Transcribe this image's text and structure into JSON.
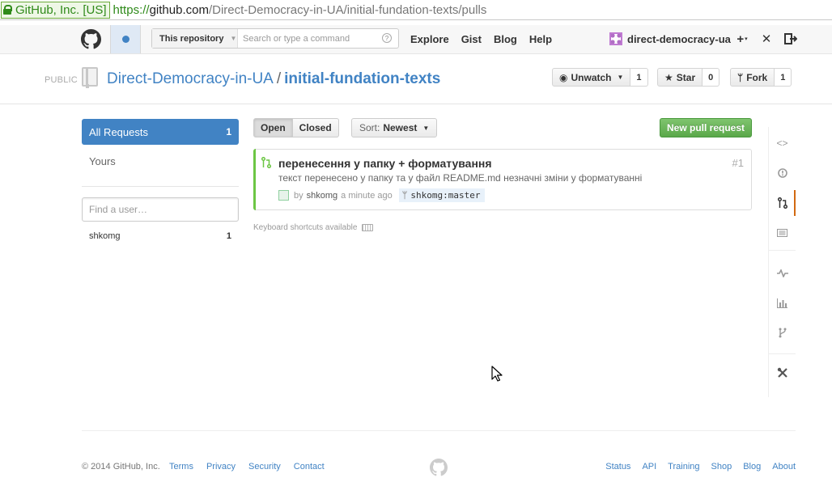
{
  "browser": {
    "identity": "GitHub, Inc. [US]",
    "url_scheme": "https://",
    "url_host": "github.com",
    "url_path": "/Direct-Democracy-in-UA/initial-fundation-texts/pulls"
  },
  "header": {
    "search_scope": "This repository",
    "search_placeholder": "Search or type a command",
    "search_help": "?",
    "nav": [
      "Explore",
      "Gist",
      "Blog",
      "Help"
    ],
    "username": "direct-democracy-ua",
    "plus_icon": "plus-icon",
    "settings_icon": "tools-icon",
    "signout_icon": "sign-out-icon"
  },
  "repo": {
    "visibility": "PUBLIC",
    "owner": "Direct-Democracy-in-UA",
    "separator": "/",
    "name": "initial-fundation-texts",
    "unwatch_label": "Unwatch",
    "unwatch_count": "1",
    "star_label": "Star",
    "star_count": "0",
    "fork_label": "Fork",
    "fork_count": "1"
  },
  "sidebar": {
    "all_requests_label": "All Requests",
    "all_requests_count": "1",
    "yours_label": "Yours",
    "find_user_placeholder": "Find a user…",
    "users": [
      {
        "name": "shkomg",
        "count": "1"
      }
    ]
  },
  "filters": {
    "open_label": "Open",
    "closed_label": "Closed",
    "sort_prefix": "Sort:",
    "sort_value": "Newest",
    "new_pr_label": "New pull request"
  },
  "pull_requests": [
    {
      "title": "перенесення у папку + форматування",
      "number": "#1",
      "description": "текст перенесено у папку та у файл README.md незначні зміни у форматуванні",
      "by": "by",
      "author": "shkomg",
      "time": "a minute ago",
      "branch": "shkomg:master"
    }
  ],
  "keyboard_hint": "Keyboard shortcuts available",
  "repo_nav_icons": [
    "code-icon",
    "issues-icon",
    "pull-requests-icon",
    "wiki-icon",
    "pulse-icon",
    "graphs-icon",
    "network-icon",
    "settings-icon"
  ],
  "colors": {
    "link": "#4183c4",
    "green": "#6cc644",
    "active_nav": "#d26911"
  },
  "footer": {
    "copyright": "© 2014 GitHub, Inc.",
    "left_links": [
      "Terms",
      "Privacy",
      "Security",
      "Contact"
    ],
    "right_links": [
      "Status",
      "API",
      "Training",
      "Shop",
      "Blog",
      "About"
    ]
  }
}
